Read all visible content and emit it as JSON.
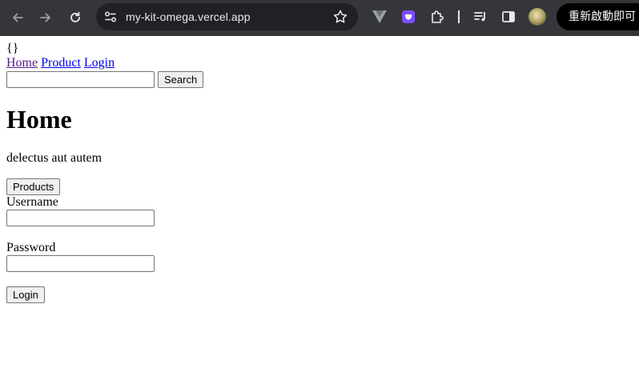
{
  "browser": {
    "url": "my-kit-omega.vercel.app",
    "restart_label": "重新啟動即可"
  },
  "page": {
    "brace_text": "{}",
    "nav": [
      {
        "label": "Home"
      },
      {
        "label": "Product"
      },
      {
        "label": "Login"
      }
    ],
    "search": {
      "value": "",
      "button_label": "Search"
    },
    "heading": "Home",
    "description": "delectus aut autem",
    "products_button": "Products",
    "login_form": {
      "username_label": "Username",
      "username_value": "",
      "password_label": "Password",
      "password_value": "",
      "login_button": "Login"
    }
  }
}
